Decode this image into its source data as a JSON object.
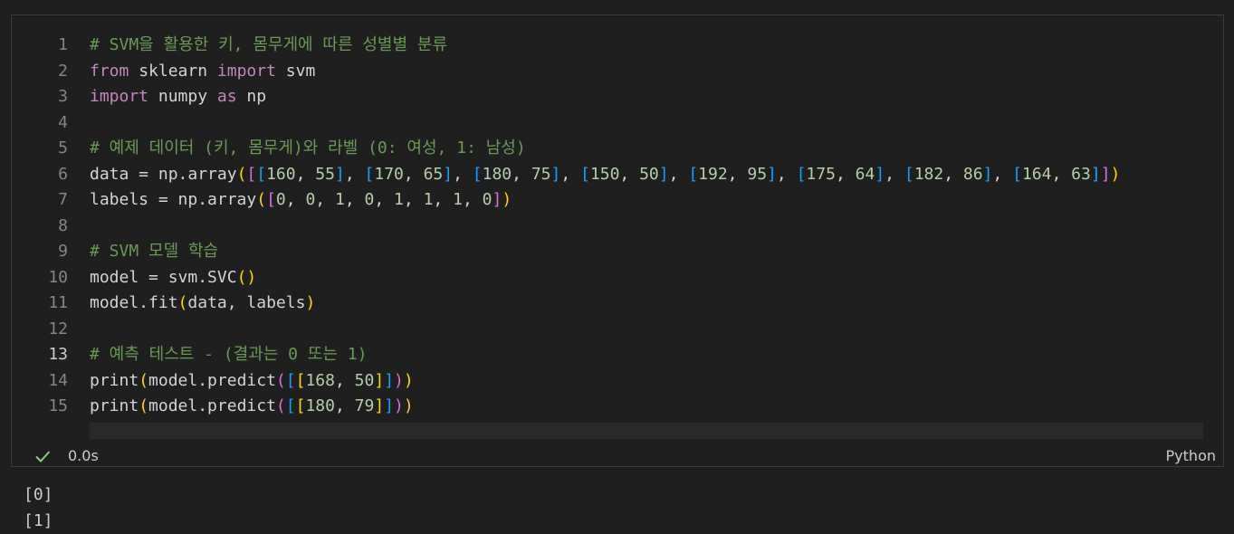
{
  "code_lines": [
    {
      "num": "1",
      "tokens": [
        {
          "t": "# SVM을 활용한 키, 몸무게에 따른 성별별 분류",
          "c": "c"
        }
      ]
    },
    {
      "num": "2",
      "tokens": [
        {
          "t": "from",
          "c": "k"
        },
        {
          "t": " sklearn ",
          "c": "v"
        },
        {
          "t": "import",
          "c": "k"
        },
        {
          "t": " svm",
          "c": "v"
        }
      ]
    },
    {
      "num": "3",
      "tokens": [
        {
          "t": "import",
          "c": "k"
        },
        {
          "t": " numpy ",
          "c": "v"
        },
        {
          "t": "as",
          "c": "k"
        },
        {
          "t": " np",
          "c": "v"
        }
      ]
    },
    {
      "num": "4",
      "tokens": []
    },
    {
      "num": "5",
      "tokens": [
        {
          "t": "# 예제 데이터 (키, 몸무게)와 라벨 (0: 여성, 1: 남성)",
          "c": "c"
        }
      ]
    },
    {
      "num": "6",
      "tokens": [
        {
          "t": "data = np.array",
          "c": "v"
        },
        {
          "t": "(",
          "c": "b1"
        },
        {
          "t": "[",
          "c": "b2"
        },
        {
          "t": "[",
          "c": "b3"
        },
        {
          "t": "160",
          "c": "n"
        },
        {
          "t": ", ",
          "c": "v"
        },
        {
          "t": "55",
          "c": "n"
        },
        {
          "t": "]",
          "c": "b3"
        },
        {
          "t": ", ",
          "c": "v"
        },
        {
          "t": "[",
          "c": "b3"
        },
        {
          "t": "170",
          "c": "n"
        },
        {
          "t": ", ",
          "c": "v"
        },
        {
          "t": "65",
          "c": "n"
        },
        {
          "t": "]",
          "c": "b3"
        },
        {
          "t": ", ",
          "c": "v"
        },
        {
          "t": "[",
          "c": "b3"
        },
        {
          "t": "180",
          "c": "n"
        },
        {
          "t": ", ",
          "c": "v"
        },
        {
          "t": "75",
          "c": "n"
        },
        {
          "t": "]",
          "c": "b3"
        },
        {
          "t": ", ",
          "c": "v"
        },
        {
          "t": "[",
          "c": "b3"
        },
        {
          "t": "150",
          "c": "n"
        },
        {
          "t": ", ",
          "c": "v"
        },
        {
          "t": "50",
          "c": "n"
        },
        {
          "t": "]",
          "c": "b3"
        },
        {
          "t": ", ",
          "c": "v"
        },
        {
          "t": "[",
          "c": "b3"
        },
        {
          "t": "192",
          "c": "n"
        },
        {
          "t": ", ",
          "c": "v"
        },
        {
          "t": "95",
          "c": "n"
        },
        {
          "t": "]",
          "c": "b3"
        },
        {
          "t": ", ",
          "c": "v"
        },
        {
          "t": "[",
          "c": "b3"
        },
        {
          "t": "175",
          "c": "n"
        },
        {
          "t": ", ",
          "c": "v"
        },
        {
          "t": "64",
          "c": "n"
        },
        {
          "t": "]",
          "c": "b3"
        },
        {
          "t": ", ",
          "c": "v"
        },
        {
          "t": "[",
          "c": "b3"
        },
        {
          "t": "182",
          "c": "n"
        },
        {
          "t": ", ",
          "c": "v"
        },
        {
          "t": "86",
          "c": "n"
        },
        {
          "t": "]",
          "c": "b3"
        },
        {
          "t": ", ",
          "c": "v"
        },
        {
          "t": "[",
          "c": "b3"
        },
        {
          "t": "164",
          "c": "n"
        },
        {
          "t": ", ",
          "c": "v"
        },
        {
          "t": "63",
          "c": "n"
        },
        {
          "t": "]",
          "c": "b3"
        },
        {
          "t": "]",
          "c": "b2"
        },
        {
          "t": ")",
          "c": "b1"
        }
      ]
    },
    {
      "num": "7",
      "tokens": [
        {
          "t": "labels = np.array",
          "c": "v"
        },
        {
          "t": "(",
          "c": "b1"
        },
        {
          "t": "[",
          "c": "b2"
        },
        {
          "t": "0",
          "c": "n"
        },
        {
          "t": ", ",
          "c": "v"
        },
        {
          "t": "0",
          "c": "n"
        },
        {
          "t": ", ",
          "c": "v"
        },
        {
          "t": "1",
          "c": "n"
        },
        {
          "t": ", ",
          "c": "v"
        },
        {
          "t": "0",
          "c": "n"
        },
        {
          "t": ", ",
          "c": "v"
        },
        {
          "t": "1",
          "c": "n"
        },
        {
          "t": ", ",
          "c": "v"
        },
        {
          "t": "1",
          "c": "n"
        },
        {
          "t": ", ",
          "c": "v"
        },
        {
          "t": "1",
          "c": "n"
        },
        {
          "t": ", ",
          "c": "v"
        },
        {
          "t": "0",
          "c": "n"
        },
        {
          "t": "]",
          "c": "b2"
        },
        {
          "t": ")",
          "c": "b1"
        }
      ]
    },
    {
      "num": "8",
      "tokens": []
    },
    {
      "num": "9",
      "tokens": [
        {
          "t": "# SVM 모델 학습",
          "c": "c"
        }
      ]
    },
    {
      "num": "10",
      "tokens": [
        {
          "t": "model = svm.SVC",
          "c": "v"
        },
        {
          "t": "(",
          "c": "b1"
        },
        {
          "t": ")",
          "c": "b1"
        }
      ]
    },
    {
      "num": "11",
      "tokens": [
        {
          "t": "model.fit",
          "c": "v"
        },
        {
          "t": "(",
          "c": "b1"
        },
        {
          "t": "data, labels",
          "c": "v"
        },
        {
          "t": ")",
          "c": "b1"
        }
      ]
    },
    {
      "num": "12",
      "tokens": []
    },
    {
      "num": "13",
      "tokens": [
        {
          "t": "# 예측 테스트 - (결과는 0 또는 1)",
          "c": "c"
        }
      ]
    },
    {
      "num": "14",
      "tokens": [
        {
          "t": "print",
          "c": "v"
        },
        {
          "t": "(",
          "c": "b1"
        },
        {
          "t": "model.predict",
          "c": "v"
        },
        {
          "t": "(",
          "c": "b2"
        },
        {
          "t": "[",
          "c": "b3"
        },
        {
          "t": "[",
          "c": "b1"
        },
        {
          "t": "168",
          "c": "n"
        },
        {
          "t": ", ",
          "c": "v"
        },
        {
          "t": "50",
          "c": "n"
        },
        {
          "t": "]",
          "c": "b1"
        },
        {
          "t": "]",
          "c": "b3"
        },
        {
          "t": ")",
          "c": "b2"
        },
        {
          "t": ")",
          "c": "b1"
        }
      ]
    },
    {
      "num": "15",
      "tokens": [
        {
          "t": "print",
          "c": "v"
        },
        {
          "t": "(",
          "c": "b1"
        },
        {
          "t": "model.predict",
          "c": "v"
        },
        {
          "t": "(",
          "c": "b2"
        },
        {
          "t": "[",
          "c": "b3"
        },
        {
          "t": "[",
          "c": "b1"
        },
        {
          "t": "180",
          "c": "n"
        },
        {
          "t": ", ",
          "c": "v"
        },
        {
          "t": "79",
          "c": "n"
        },
        {
          "t": "]",
          "c": "b1"
        },
        {
          "t": "]",
          "c": "b3"
        },
        {
          "t": ")",
          "c": "b2"
        },
        {
          "t": ")",
          "c": "b1"
        }
      ]
    }
  ],
  "active_line": "13",
  "status": {
    "check_icon": "check-icon",
    "exec_time": "0.0s",
    "language": "Python"
  },
  "output": [
    "[0]",
    "[1]"
  ]
}
